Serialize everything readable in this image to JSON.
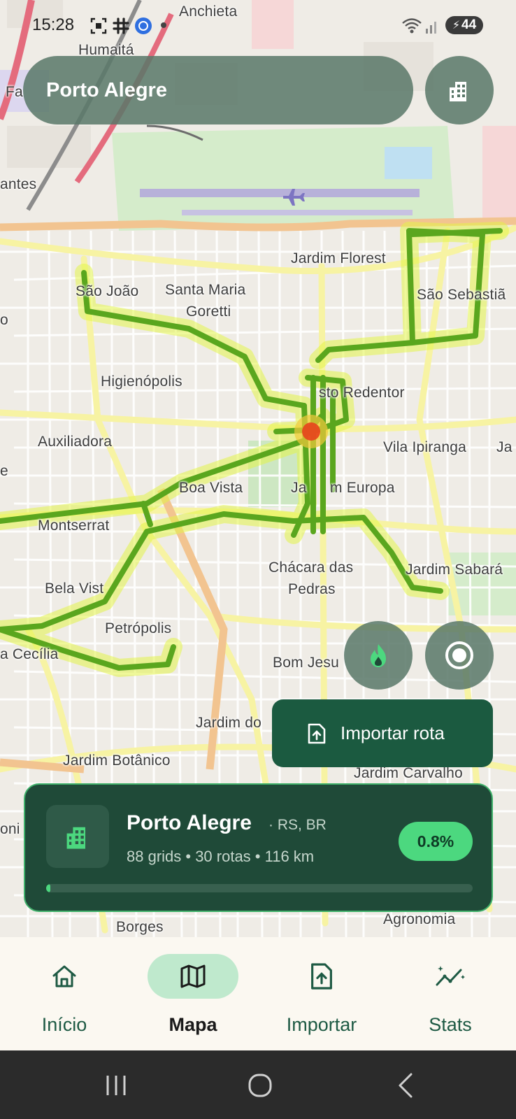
{
  "status_bar": {
    "time": "15:28",
    "battery": "44"
  },
  "search": {
    "value": "Porto Alegre"
  },
  "map": {
    "labels": [
      "Anchieta",
      "Humaitá",
      "Fa",
      "antes",
      "Jardim Florest",
      "São João",
      "Santa Maria",
      "Goretti",
      "São Sebastiã",
      "o",
      "Higienópolis",
      "sto Redentor",
      "Auxiliadora",
      "Vila Ipiranga",
      "Ja",
      "e",
      "Boa Vista",
      "Ja",
      "m Europa",
      "Montserrat",
      "Chácara das",
      "Pedras",
      "Jardim Sabará",
      "Bela Vist",
      "Petrópolis",
      "a Cecília",
      "Bom Jesu",
      "Jardim do",
      "Jardim Botânico",
      "Jardim Carvalho",
      "oni",
      "Borges",
      "Agronomia"
    ],
    "heatmap_colors": {
      "route": "#5aa61e",
      "glow": "#e4f54a",
      "hotspot": "#e8421c"
    }
  },
  "actions": {
    "import_route_label": "Importar rota",
    "heatmap_icon": "flame-icon",
    "record_icon": "record-icon",
    "city_icon": "buildings-icon"
  },
  "city_card": {
    "name": "Porto Alegre",
    "region": "· RS, BR",
    "stats": "88 grids • 30 rotas • 116 km",
    "percent": "0.8%",
    "progress_fraction": 0.008
  },
  "bottom_nav": {
    "items": [
      {
        "label": "Início",
        "icon": "home-icon",
        "active": false
      },
      {
        "label": "Mapa",
        "icon": "map-icon",
        "active": true
      },
      {
        "label": "Importar",
        "icon": "file-upload-icon",
        "active": false
      },
      {
        "label": "Stats",
        "icon": "chart-sparkle-icon",
        "active": false
      }
    ]
  },
  "colors": {
    "accent": "#4cd87f",
    "card_bg": "#1f4a38",
    "button_bg": "#1b5a40",
    "nav_active_pill": "#bfe9cd"
  }
}
